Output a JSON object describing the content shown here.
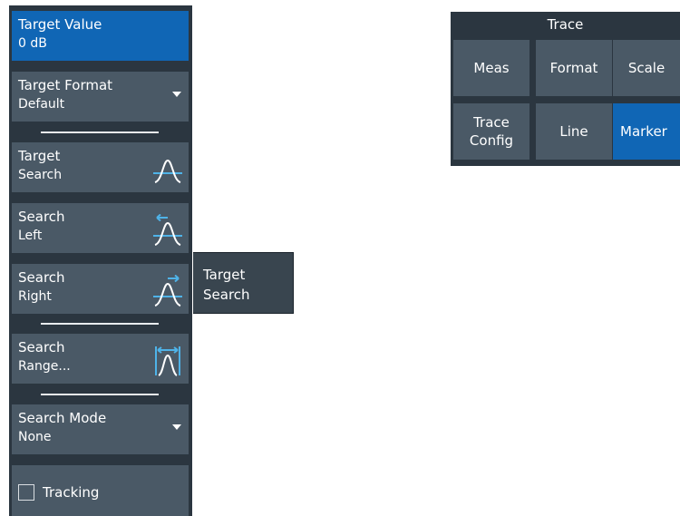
{
  "softkeys": {
    "target_value": {
      "label": "Target Value",
      "value": "0 dB"
    },
    "target_format": {
      "label": "Target Format",
      "value": "Default"
    },
    "target_search": {
      "line1": "Target",
      "line2": "Search",
      "icon": "peak-target-icon"
    },
    "search_left": {
      "line1": "Search",
      "line2": "Left",
      "icon": "search-left-icon"
    },
    "search_right": {
      "line1": "Search",
      "line2": "Right",
      "icon": "search-right-icon"
    },
    "search_range": {
      "line1": "Search",
      "line2": "Range...",
      "icon": "search-range-icon"
    },
    "search_mode": {
      "label": "Search Mode",
      "value": "None"
    },
    "tracking": {
      "label": "Tracking",
      "checked": false
    }
  },
  "flyout": {
    "line1": "Target",
    "line2": "Search"
  },
  "trace_menu": {
    "title": "Trace",
    "buttons": [
      {
        "label": "Meas",
        "active": false
      },
      {
        "label": "Format",
        "active": false
      },
      {
        "label": "Scale",
        "active": false
      },
      {
        "label": "Trace\nConfig",
        "active": false
      },
      {
        "label": "Line",
        "active": false
      },
      {
        "label": "Marker",
        "active": true
      }
    ]
  },
  "colors": {
    "panel": "#2b3640",
    "button": "#4a5966",
    "active": "#1066b5",
    "icon_accent": "#4fb3e8"
  }
}
